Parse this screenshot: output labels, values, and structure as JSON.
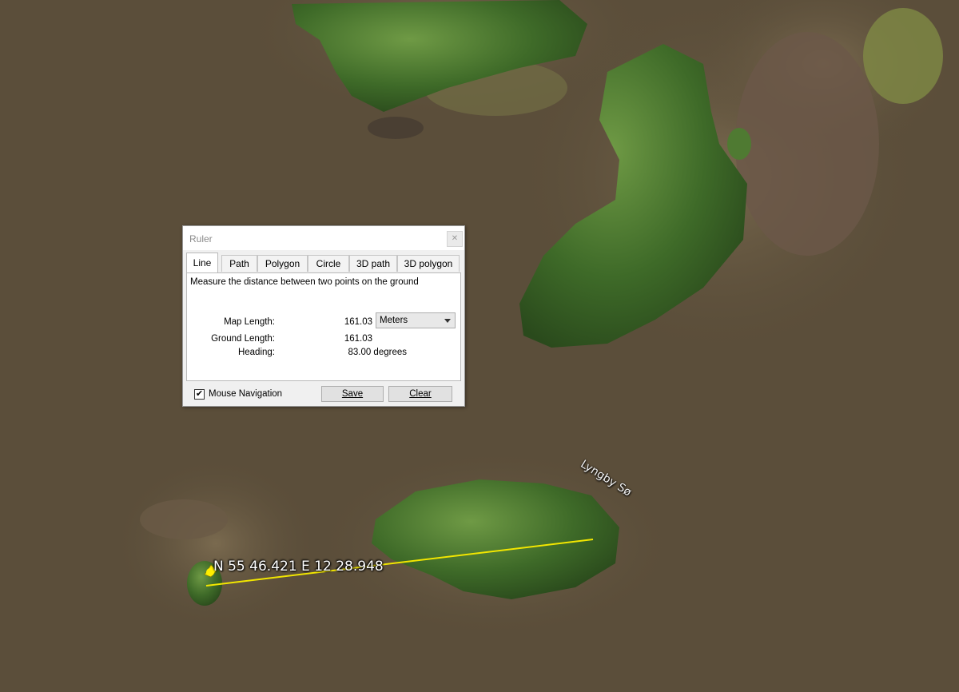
{
  "map": {
    "place_label": "Lyngby Sø",
    "coordinate_label": "N 55 46.421 E 12 28.948",
    "colors": {
      "water": "#5b4e3a",
      "vegetation": "#3f6b2a",
      "measure_line": "#f2e600"
    }
  },
  "ruler": {
    "title": "Ruler",
    "close_icon": "close-icon",
    "tabs": [
      "Line",
      "Path",
      "Polygon",
      "Circle",
      "3D path",
      "3D polygon"
    ],
    "active_tab": "Line",
    "description": "Measure the distance between two points on the ground",
    "map_length_label": "Map Length:",
    "map_length_value": "161.03",
    "unit": "Meters",
    "ground_length_label": "Ground Length:",
    "ground_length_value": "161.03",
    "heading_label": "Heading:",
    "heading_value": "83.00 degrees",
    "mouse_navigation_label": "Mouse Navigation",
    "mouse_navigation_checked": "✔",
    "save_label": "Save",
    "clear_label": "Clear"
  }
}
